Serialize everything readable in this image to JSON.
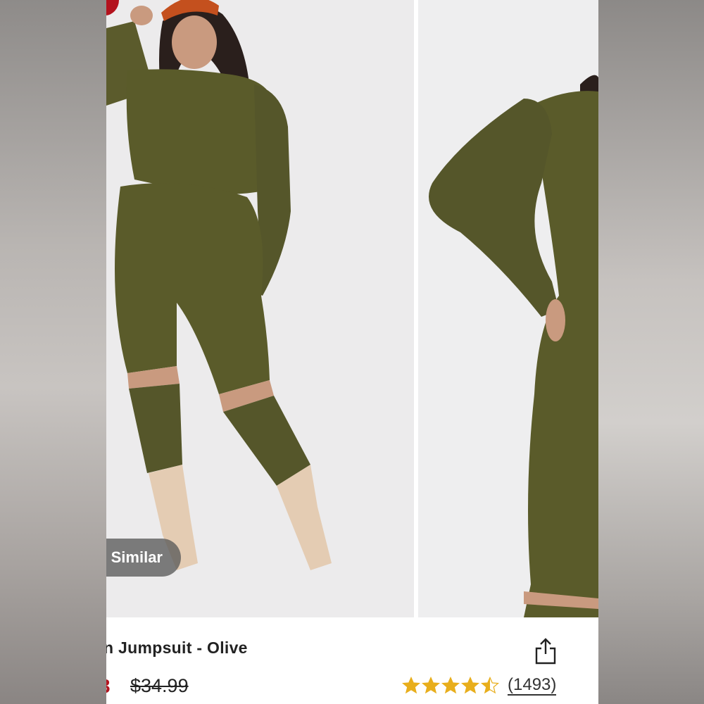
{
  "product": {
    "title": "n Jumpsuit - Olive",
    "sale_price": "3",
    "original_price": "$34.99",
    "review_count": "(1493)",
    "rating": 4.5,
    "rating_max": 5
  },
  "gallery": {
    "similar_label": "Similar"
  },
  "colors": {
    "olive": "#5a5b2a",
    "sale_red": "#b3121d",
    "star_gold": "#e8ae1c"
  },
  "icons": {
    "share": "share-icon",
    "star": "star-icon"
  }
}
